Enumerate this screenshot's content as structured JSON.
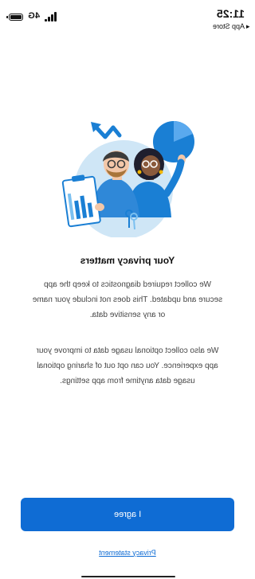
{
  "status_bar": {
    "time": "11:25",
    "back_app": "◂ App Store",
    "network": "4G",
    "battery_icon": "battery-icon",
    "signal_icon": "signal-icon"
  },
  "onboarding": {
    "title": "Your privacy matters",
    "paragraph_1": "We collect required diagnostics to keep the app secure and updated. This does not include your name or any sensitive data.",
    "paragraph_2": "We also collect optional usage data to improve your app experience. You can opt out of sharing optional usage data anytime from app settings."
  },
  "actions": {
    "agree_label": "I agree",
    "privacy_link": "Privacy statement"
  },
  "colors": {
    "accent": "#0f6cd4",
    "illustration_bg": "#cfe6f6",
    "illustration_blue": "#1a7fd4"
  }
}
